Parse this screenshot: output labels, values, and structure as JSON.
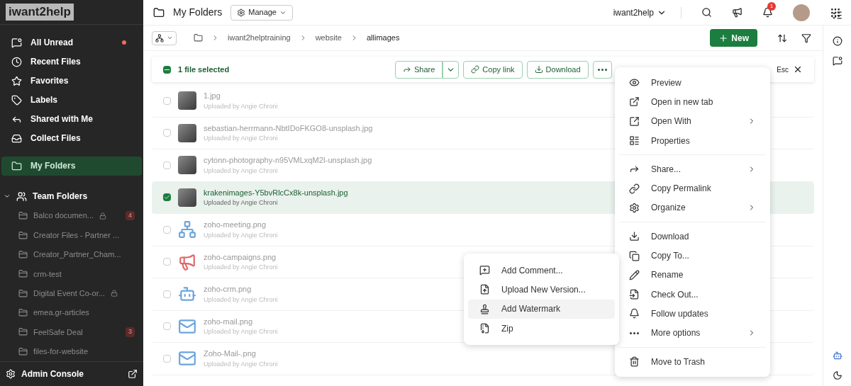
{
  "brand": {
    "logo": "iwant2help"
  },
  "sidebar": {
    "items": [
      {
        "label": "All Unread",
        "unread": true,
        "selected": false
      },
      {
        "label": "Recent Files",
        "unread": false,
        "selected": false
      },
      {
        "label": "Favorites",
        "unread": false,
        "selected": false
      },
      {
        "label": "Labels",
        "unread": false,
        "selected": false
      },
      {
        "label": "Shared with Me",
        "unread": false,
        "selected": false
      },
      {
        "label": "Collect Files",
        "unread": false,
        "selected": false
      },
      {
        "label": "My Folders",
        "unread": false,
        "selected": true
      }
    ],
    "team_folders": {
      "label": "Team Folders",
      "expanded": true,
      "children": [
        {
          "label": "Balco documen...",
          "locked": true,
          "badge": "4"
        },
        {
          "label": "Creator Files - Partner ...",
          "locked": false
        },
        {
          "label": "Creator_Partner_Cham...",
          "locked": false
        },
        {
          "label": "crm-test",
          "locked": false
        },
        {
          "label": "Digital Event Co-or...",
          "locked": true
        },
        {
          "label": "emea.gr-articles",
          "locked": false
        },
        {
          "label": "FeelSafe Deal",
          "locked": false,
          "badge": "3"
        },
        {
          "label": "files-for-website",
          "locked": false
        }
      ]
    },
    "admin": {
      "label": "Admin Console"
    }
  },
  "header": {
    "title": "My Folders",
    "manage": "Manage",
    "account": "iwant2help",
    "notifications": "1"
  },
  "breadcrumb": [
    "iwant2helptraining",
    "website",
    "allimages"
  ],
  "new_button": "New",
  "selection_bar": {
    "label": "1 file selected",
    "share": "Share",
    "copy_link": "Copy link",
    "download": "Download",
    "esc": "Esc"
  },
  "files": [
    {
      "name": "1.jpg",
      "uploader": "Uploaded by Angie Chroni",
      "selected": false,
      "kind": "photo"
    },
    {
      "name": "sebastian-herrmann-NbtIDoFKGO8-unsplash.jpg",
      "uploader": "Uploaded by Angie Chroni",
      "selected": false,
      "kind": "photo"
    },
    {
      "name": "cytonn-photography-n95VMLxqM2I-unsplash.jpg",
      "uploader": "Uploaded by Angie Chroni",
      "selected": false,
      "kind": "photo"
    },
    {
      "name": "krakenimages-Y5bvRlcCx8k-unsplash.jpg",
      "uploader": "Uploaded by Angie Chroni",
      "selected": true,
      "kind": "photo"
    },
    {
      "name": "zoho-meeting.png",
      "uploader": "Uploaded by Angie Chroni",
      "selected": false,
      "kind": "meeting"
    },
    {
      "name": "zoho-campaigns.png",
      "uploader": "Uploaded by Angie Chroni",
      "selected": false,
      "kind": "campaign"
    },
    {
      "name": "zoho-crm.png",
      "uploader": "Uploaded by Angie Chroni",
      "selected": false,
      "kind": "crm"
    },
    {
      "name": "zoho-mail.png",
      "uploader": "Uploaded by Angie Chroni",
      "selected": false,
      "kind": "mail"
    },
    {
      "name": "Zoho-Mail-.png",
      "uploader": "Uploaded by Angie Chroni",
      "selected": false,
      "kind": "mail"
    }
  ],
  "context_menu": {
    "groups": [
      [
        {
          "label": "Preview",
          "submenu": false
        },
        {
          "label": "Open in new tab",
          "submenu": false
        },
        {
          "label": "Open With",
          "submenu": true
        },
        {
          "label": "Properties",
          "submenu": false
        }
      ],
      [
        {
          "label": "Share...",
          "submenu": true
        },
        {
          "label": "Copy Permalink",
          "submenu": false
        },
        {
          "label": "Organize",
          "submenu": true
        }
      ],
      [
        {
          "label": "Download",
          "submenu": false
        },
        {
          "label": "Copy To...",
          "submenu": false
        },
        {
          "label": "Rename",
          "submenu": false
        },
        {
          "label": "Check Out...",
          "submenu": false
        },
        {
          "label": "Follow updates",
          "submenu": false
        },
        {
          "label": "More options",
          "submenu": true
        }
      ],
      [
        {
          "label": "Move to Trash",
          "submenu": false
        }
      ]
    ]
  },
  "submenu": [
    {
      "label": "Add Comment...",
      "highlighted": false
    },
    {
      "label": "Upload New Version...",
      "highlighted": false
    },
    {
      "label": "Add Watermark",
      "highlighted": true
    },
    {
      "label": "Zip",
      "highlighted": false
    }
  ]
}
